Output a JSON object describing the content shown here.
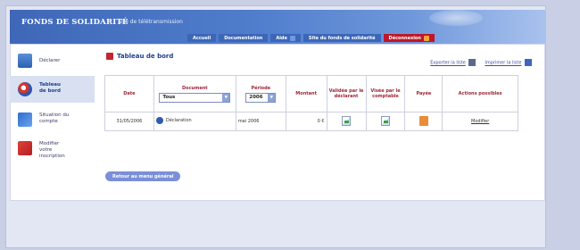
{
  "header": {
    "logo": "FONDS DE SOLIDARITÉ",
    "subtitle": "site de télétransmission"
  },
  "nav": {
    "tabs": [
      {
        "label": "Accueil"
      },
      {
        "label": "Documentation"
      },
      {
        "label": "Aide"
      },
      {
        "label": "Site du fonds de solidarité"
      },
      {
        "label": "Déconnexion"
      }
    ]
  },
  "sidebar": {
    "items": [
      {
        "label": "Déclarer",
        "icon": "user-icon"
      },
      {
        "label": "Tableau de bord",
        "icon": "dashboard-icon"
      },
      {
        "label": "Situation du compte",
        "icon": "account-icon"
      },
      {
        "label": "Modifier votre inscription",
        "icon": "book-icon"
      }
    ]
  },
  "main": {
    "title": "Tableau de bord",
    "export_label": "Exporter la liste",
    "print_label": "Imprimer la liste",
    "columns": {
      "date": "Date",
      "document": "Document",
      "period": "Période",
      "amount": "Montant",
      "validated_by_declarant": "Validée par le déclarant",
      "seen_by_accountant": "Visée par le comptable",
      "paid": "Payée",
      "actions": "Actions possibles"
    },
    "filters": {
      "document_value": "Tous",
      "period_value": "2006"
    },
    "rows": [
      {
        "date": "31/05/2006",
        "document": "Déclaration",
        "period": "mai 2006",
        "amount": "0 € ",
        "action": "Modifier"
      }
    ],
    "back_button": "Retour au menu général"
  }
}
